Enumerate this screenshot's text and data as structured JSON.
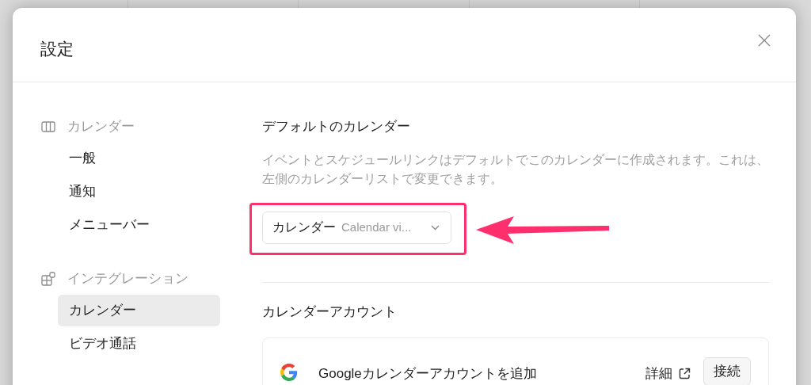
{
  "dialog": {
    "title": "設定"
  },
  "sidebar": {
    "sections": [
      {
        "kind": "calendar",
        "label": "カレンダー",
        "items": [
          {
            "label": "一般",
            "selected": false
          },
          {
            "label": "通知",
            "selected": false
          },
          {
            "label": "メニューバー",
            "selected": false
          }
        ]
      },
      {
        "kind": "integrations",
        "label": "インテグレーション",
        "items": [
          {
            "label": "カレンダー",
            "selected": true
          },
          {
            "label": "ビデオ通話",
            "selected": false
          }
        ]
      }
    ]
  },
  "default_calendar": {
    "heading": "デフォルトのカレンダー",
    "description": "イベントとスケジュールリンクはデフォルトでこのカレンダーに作成されます。これは、左側のカレンダーリストで変更できます。",
    "select": {
      "value": "カレンダー",
      "detail": "Calendar vi..."
    }
  },
  "calendar_accounts": {
    "heading": "カレンダーアカウント",
    "rows": [
      {
        "label": "Googleカレンダーアカウントを追加",
        "link": "詳細",
        "button": "接続"
      }
    ]
  }
}
